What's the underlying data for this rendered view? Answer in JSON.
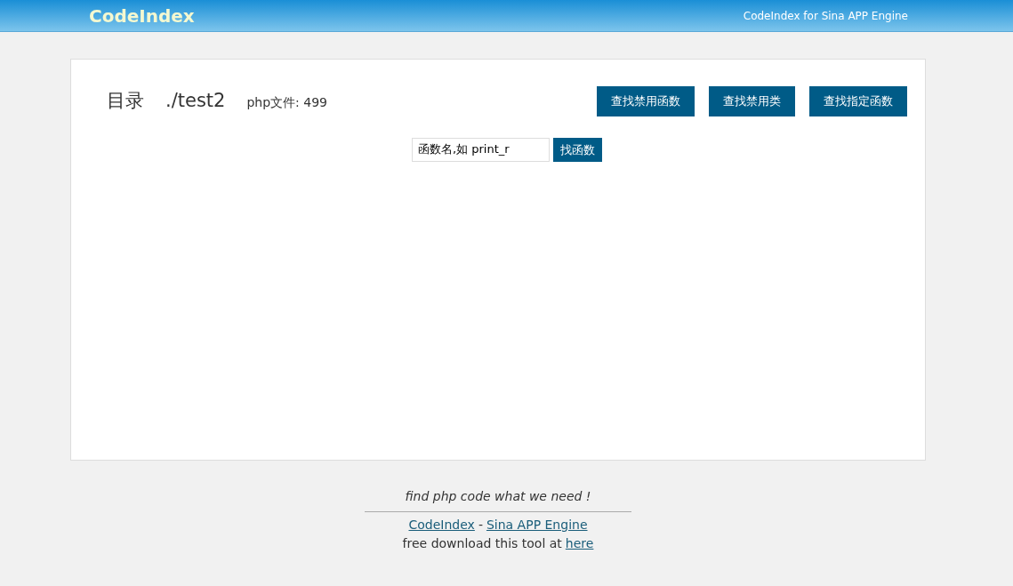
{
  "header": {
    "logo": "CodeIndex",
    "tagline": "CodeIndex for Sina APP Engine"
  },
  "main": {
    "title": "目录",
    "path": "./test2",
    "file_count": "php文件: 499",
    "buttons": [
      "查找禁用函数",
      "查找禁用类",
      "查找指定函数"
    ],
    "search": {
      "value": "函数名,如 print_r",
      "button": "找函数"
    }
  },
  "footer": {
    "slogan": "find php code what we need !",
    "link_1": "CodeIndex",
    "separator": "-",
    "link_2": "Sina APP Engine",
    "download_text": "free download this tool at",
    "download_link": "here"
  }
}
